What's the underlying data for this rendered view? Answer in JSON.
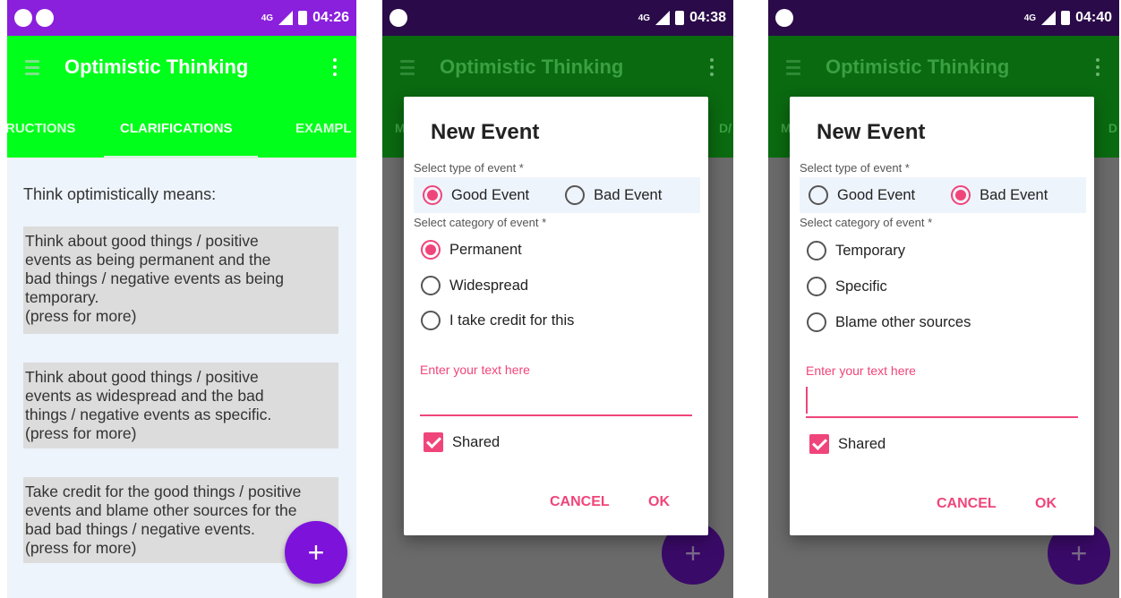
{
  "colors": {
    "statusbar_active": "#8a1fdc",
    "toolbar_green": "#00ff1a",
    "toolbar_green_dimmed": "#0a6a10",
    "fab_purple": "#7d12db",
    "accent_pink": "#f0457a",
    "card_grey": "#dcdcdc"
  },
  "screen1": {
    "status": {
      "signal": "4G",
      "time": "04:26"
    },
    "toolbar": {
      "title": "Optimistic Thinking",
      "menu_icon": "hamburger-icon",
      "overflow_icon": "more-vert-icon"
    },
    "tabs": {
      "left": "RUCTIONS",
      "active": "CLARIFICATIONS",
      "right": "EXAMPL"
    },
    "lead": "Think optimistically means:",
    "cards": [
      "Think about good things / positive\nevents as being permanent and the\nbad things / negative events as being\ntemporary.\n(press for more)",
      "Think about good things / positive\nevents as widespread and the bad\nthings / negative events as specific.\n(press for more)",
      "Take credit for the good things / positive\nevents and blame other sources for the\nbad bad things / negative events.\n(press for more)"
    ],
    "fab_label": "+"
  },
  "screen2": {
    "status": {
      "signal": "4G",
      "time": "04:38"
    },
    "toolbar": {
      "title": "Optimistic Thinking"
    },
    "tabs": {
      "left": "M",
      "right": "D/"
    },
    "dialog": {
      "title": "New Event",
      "type_label": "Select type of event *",
      "type_options": [
        "Good Event",
        "Bad Event"
      ],
      "type_selected": "Good Event",
      "category_label": "Select category of event *",
      "categories": [
        "Permanent",
        "Widespread",
        "I take credit for this"
      ],
      "category_selected": "Permanent",
      "text_label": "Enter your text here",
      "text_value": "",
      "shared_label": "Shared",
      "shared_checked": true,
      "cancel": "CANCEL",
      "ok": "OK"
    },
    "fab_label": "+"
  },
  "screen3": {
    "status": {
      "signal": "4G",
      "time": "04:40"
    },
    "toolbar": {
      "title": "Optimistic Thinking"
    },
    "tabs": {
      "left": "M",
      "right": "D"
    },
    "dialog": {
      "title": "New Event",
      "type_label": "Select type of event *",
      "type_options": [
        "Good Event",
        "Bad Event"
      ],
      "type_selected": "Bad Event",
      "category_label": "Select category of event *",
      "categories": [
        "Temporary",
        "Specific",
        "Blame other sources"
      ],
      "category_selected": "",
      "text_label": "Enter your text here",
      "text_value": "",
      "shared_label": "Shared",
      "shared_checked": true,
      "cancel": "CANCEL",
      "ok": "OK"
    },
    "fab_label": "+"
  }
}
